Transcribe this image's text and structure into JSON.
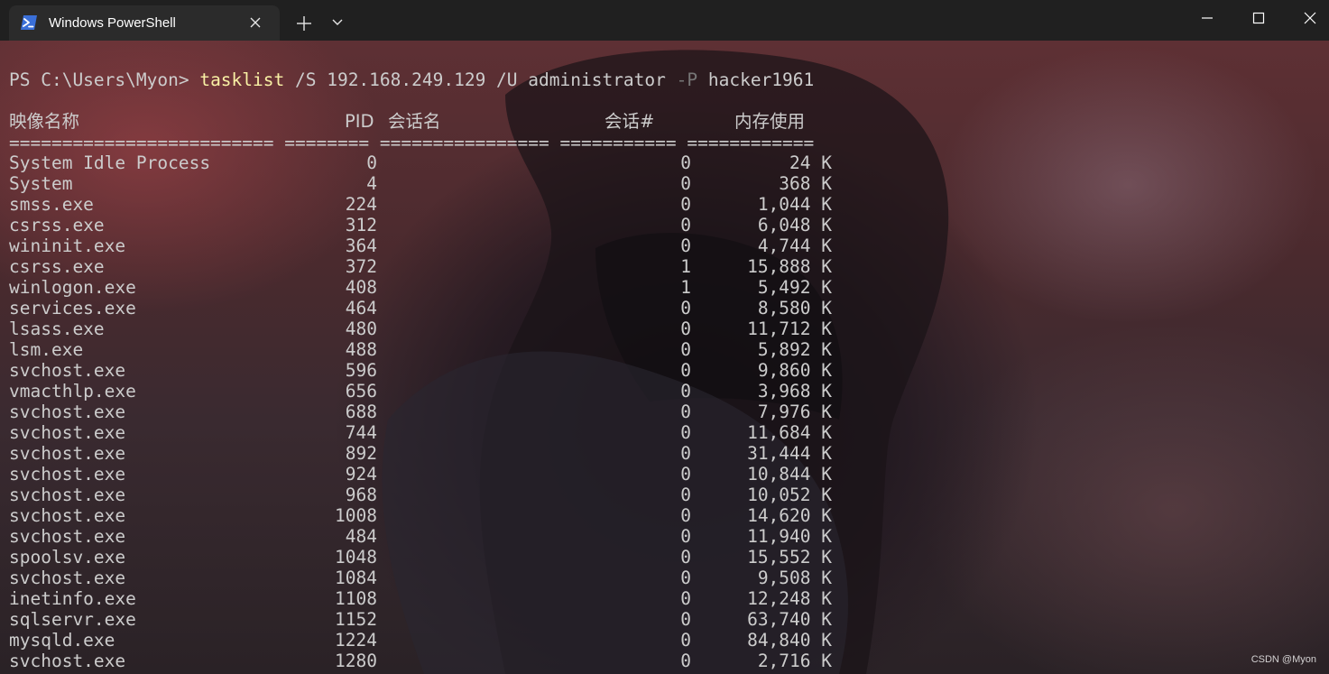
{
  "window": {
    "tab_title": "Windows PowerShell",
    "tab_icon": "powershell-icon",
    "close_tab_icon": "close-icon",
    "new_tab_icon": "plus-icon",
    "dropdown_icon": "chevron-down-icon",
    "controls": [
      "minimize-icon",
      "maximize-icon",
      "close-icon"
    ]
  },
  "terminal": {
    "prompt": "PS C:\\Users\\Myon> ",
    "command": "tasklist",
    "args_1": " /S 192.168.249.129 /U administrator ",
    "flag_p": "-P",
    "args_2": " hacker1961",
    "headers": {
      "image_name": "映像名称",
      "pid": "PID",
      "session_name": "会话名",
      "session_num": "会话#",
      "mem_usage": "内存使用"
    },
    "separator": "========================= ======== ================ =========== ============",
    "processes": [
      {
        "name": "System Idle Process",
        "pid": "0",
        "session": "0",
        "mem": "24 K"
      },
      {
        "name": "System",
        "pid": "4",
        "session": "0",
        "mem": "368 K"
      },
      {
        "name": "smss.exe",
        "pid": "224",
        "session": "0",
        "mem": "1,044 K"
      },
      {
        "name": "csrss.exe",
        "pid": "312",
        "session": "0",
        "mem": "6,048 K"
      },
      {
        "name": "wininit.exe",
        "pid": "364",
        "session": "0",
        "mem": "4,744 K"
      },
      {
        "name": "csrss.exe",
        "pid": "372",
        "session": "1",
        "mem": "15,888 K"
      },
      {
        "name": "winlogon.exe",
        "pid": "408",
        "session": "1",
        "mem": "5,492 K"
      },
      {
        "name": "services.exe",
        "pid": "464",
        "session": "0",
        "mem": "8,580 K"
      },
      {
        "name": "lsass.exe",
        "pid": "480",
        "session": "0",
        "mem": "11,712 K"
      },
      {
        "name": "lsm.exe",
        "pid": "488",
        "session": "0",
        "mem": "5,892 K"
      },
      {
        "name": "svchost.exe",
        "pid": "596",
        "session": "0",
        "mem": "9,860 K"
      },
      {
        "name": "vmacthlp.exe",
        "pid": "656",
        "session": "0",
        "mem": "3,968 K"
      },
      {
        "name": "svchost.exe",
        "pid": "688",
        "session": "0",
        "mem": "7,976 K"
      },
      {
        "name": "svchost.exe",
        "pid": "744",
        "session": "0",
        "mem": "11,684 K"
      },
      {
        "name": "svchost.exe",
        "pid": "892",
        "session": "0",
        "mem": "31,444 K"
      },
      {
        "name": "svchost.exe",
        "pid": "924",
        "session": "0",
        "mem": "10,844 K"
      },
      {
        "name": "svchost.exe",
        "pid": "968",
        "session": "0",
        "mem": "10,052 K"
      },
      {
        "name": "svchost.exe",
        "pid": "1008",
        "session": "0",
        "mem": "14,620 K"
      },
      {
        "name": "svchost.exe",
        "pid": "484",
        "session": "0",
        "mem": "11,940 K"
      },
      {
        "name": "spoolsv.exe",
        "pid": "1048",
        "session": "0",
        "mem": "15,552 K"
      },
      {
        "name": "svchost.exe",
        "pid": "1084",
        "session": "0",
        "mem": "9,508 K"
      },
      {
        "name": "inetinfo.exe",
        "pid": "1108",
        "session": "0",
        "mem": "12,248 K"
      },
      {
        "name": "sqlservr.exe",
        "pid": "1152",
        "session": "0",
        "mem": "63,740 K"
      },
      {
        "name": "mysqld.exe",
        "pid": "1224",
        "session": "0",
        "mem": "84,840 K"
      },
      {
        "name": "svchost.exe",
        "pid": "1280",
        "session": "0",
        "mem": "2,716 K"
      }
    ]
  },
  "watermark": "CSDN @Myon⁠"
}
